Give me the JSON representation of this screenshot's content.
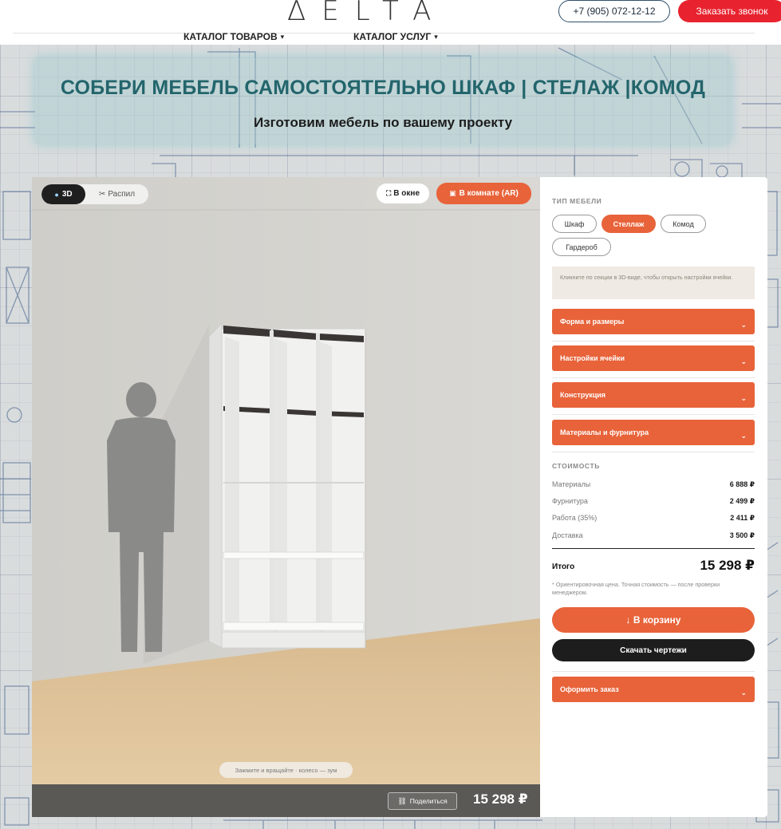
{
  "header": {
    "logo_text": "ΔELTA",
    "phone": "+7 (905) 072-12-12",
    "call_button": "Заказать звонок",
    "nav": [
      {
        "label": "КАТАЛОГ ТОВАРОВ"
      },
      {
        "label": "КАТАЛОГ УСЛУГ"
      }
    ]
  },
  "hero": {
    "title": "СОБЕРИ  МЕБЕЛЬ САМОСТОЯТЕЛЬНО ШКАФ | СТЕЛАЖ |КОМОД",
    "subtitle": "Изготовим мебель по вашему проекту"
  },
  "viewport": {
    "mode_3d": "3D",
    "mode_cut": "Распил",
    "window_button": "В окне",
    "ar_button": "В комнате (AR)",
    "hint": "Зажмите и вращайте · колесо — зум",
    "share_button": "Поделиться",
    "price": "15 298 ₽"
  },
  "panel": {
    "type_label": "ТИП МЕБЕЛИ",
    "types": [
      {
        "label": "Шкаф",
        "active": false
      },
      {
        "label": "Стеллаж",
        "active": true
      },
      {
        "label": "Комод",
        "active": false
      },
      {
        "label": "Гардероб",
        "active": false
      }
    ],
    "info": "Кликните по секции в 3D-виде, чтобы открыть настройки ячейки.",
    "accordions": [
      {
        "label": "Форма и размеры"
      },
      {
        "label": "Настройки ячейки"
      },
      {
        "label": "Конструкция"
      },
      {
        "label": "Материалы и фурнитура"
      }
    ],
    "cost_label": "СТОИМОСТЬ",
    "costs": [
      {
        "label": "Материалы",
        "value": "6 888 ₽"
      },
      {
        "label": "Фурнитура",
        "value": "2 499 ₽"
      },
      {
        "label": "Работа (35%)",
        "value": "2 411 ₽"
      },
      {
        "label": "Доставка",
        "value": "3 500 ₽"
      }
    ],
    "total_label": "Итого",
    "total_value": "15 298 ₽",
    "note": "* Ориентировочная цена. Точная стоимость — после проверки менеджером.",
    "cart_button": "↓ В корзину",
    "download_button": "Скачать чертежи",
    "order_accordion": "Оформить заказ"
  },
  "colors": {
    "accent": "#e8633a",
    "call_red": "#e8232f",
    "hero_title": "#23656c",
    "dark": "#1d1d1d"
  }
}
